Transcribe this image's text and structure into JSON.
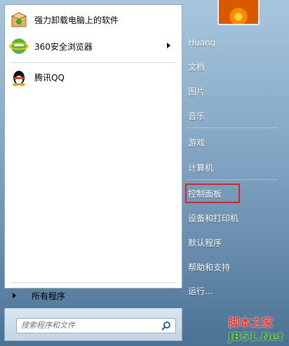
{
  "programs": [
    {
      "label": "强力卸载电脑上的软件",
      "icon": "uninstaller-box-icon"
    },
    {
      "label": "360安全浏览器",
      "icon": "360-browser-icon",
      "has_submenu": true
    },
    {
      "label": "腾讯QQ",
      "icon": "qq-penguin-icon"
    }
  ],
  "all_programs": "所有程序",
  "search": {
    "placeholder": "搜索程序和文件"
  },
  "right": {
    "user": "Huang",
    "items": [
      "文档",
      "图片",
      "音乐",
      "游戏",
      "计算机",
      "控制面板",
      "设备和打印机",
      "默认程序",
      "帮助和支持",
      "运行..."
    ]
  },
  "watermark": {
    "part1": "脚本之家",
    "part2": "JB51.Net"
  },
  "colors": {
    "highlight": "#e02020"
  }
}
